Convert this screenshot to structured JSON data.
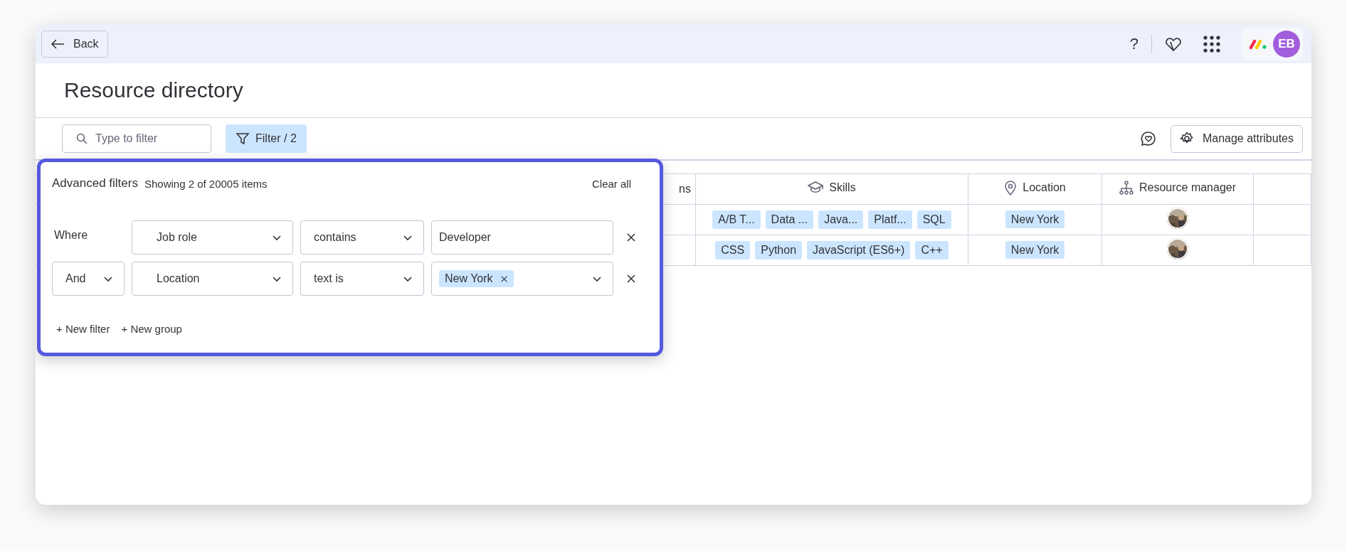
{
  "topbar": {
    "back": "Back",
    "help": "?",
    "avatar": "EB"
  },
  "title": "Resource directory",
  "toolbar": {
    "search": {
      "placeholder": "Type to filter"
    },
    "filter": "Filter / 2",
    "manage": "Manage attributes"
  },
  "table": {
    "columns": [
      "ns",
      "Skills",
      "Location",
      "Resource manager"
    ],
    "rows": [
      {
        "skills": [
          "A/B T...",
          "Data ...",
          "Java...",
          "Platf...",
          "SQL"
        ],
        "location": "New York",
        "manager": {
          "kind": "picture"
        }
      },
      {
        "skills": [
          "CSS",
          "Python",
          "JavaScript (ES6+)",
          "C++"
        ],
        "location": "New York",
        "manager": {
          "kind": "picture"
        }
      }
    ]
  },
  "filters": {
    "title": "Advanced filters",
    "summary": "Showing 2 of 20005 items",
    "clear": "Clear all",
    "rows": [
      {
        "conjunction": {
          "kind": "label",
          "text": "Where"
        },
        "field": "Job role",
        "operator": "contains",
        "value": {
          "kind": "text",
          "text": "Developer"
        }
      },
      {
        "conjunction": {
          "kind": "select",
          "text": "And"
        },
        "field": "Location",
        "operator": "text is",
        "value": {
          "kind": "tags",
          "tags": [
            "New York"
          ]
        }
      }
    ],
    "actions": [
      "+ New filter",
      "+ New group"
    ]
  }
}
